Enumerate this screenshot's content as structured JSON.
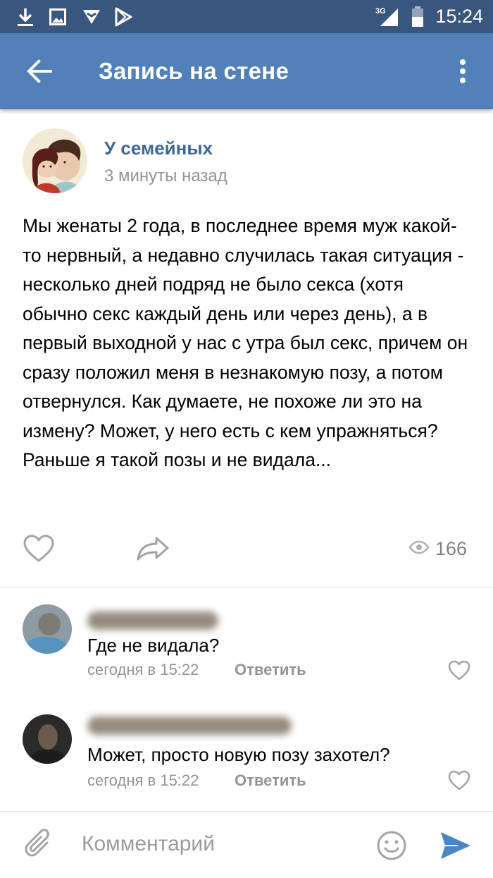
{
  "status_bar": {
    "time": "15:24",
    "network": "3G",
    "icons": [
      "download-icon",
      "image-icon",
      "app-notification-icon",
      "play-store-icon",
      "signal-icon",
      "battery-icon"
    ]
  },
  "header": {
    "title": "Запись на стене",
    "icons": [
      "back-arrow-icon",
      "more-vertical-icon"
    ]
  },
  "post": {
    "author": "У семейных",
    "time": "3 минуты назад",
    "text": "Мы женаты 2 года, в последнее время муж какой-то нервный, а недавно случилась такая ситуация - несколько дней подряд не было секса (хотя обычно секс каждый день или через день), а в первый выходной у нас с утра был секс, причем он сразу положил меня в незнакомую позу, а потом отвернулся. Как думаете, не похоже ли это на измену? Может, у него есть с кем упражняться? Раньше я такой позы и не видала...",
    "views": "166",
    "icons": [
      "heart-icon",
      "share-icon",
      "eye-icon"
    ]
  },
  "comments": [
    {
      "text": "Где не видала?",
      "date": "сегодня в 15:22",
      "reply_label": "Ответить"
    },
    {
      "text": "Может, просто новую позу захотел?",
      "date": "сегодня в 15:22",
      "reply_label": "Ответить"
    }
  ],
  "composer": {
    "placeholder": "Комментарий",
    "icons": [
      "paperclip-icon",
      "emoji-icon",
      "send-icon"
    ]
  },
  "colors": {
    "status_bar": "#39577e",
    "app_bar": "#5181b8",
    "author_name": "#3e6798",
    "secondary_text": "#939393",
    "send": "#4a86c5"
  }
}
